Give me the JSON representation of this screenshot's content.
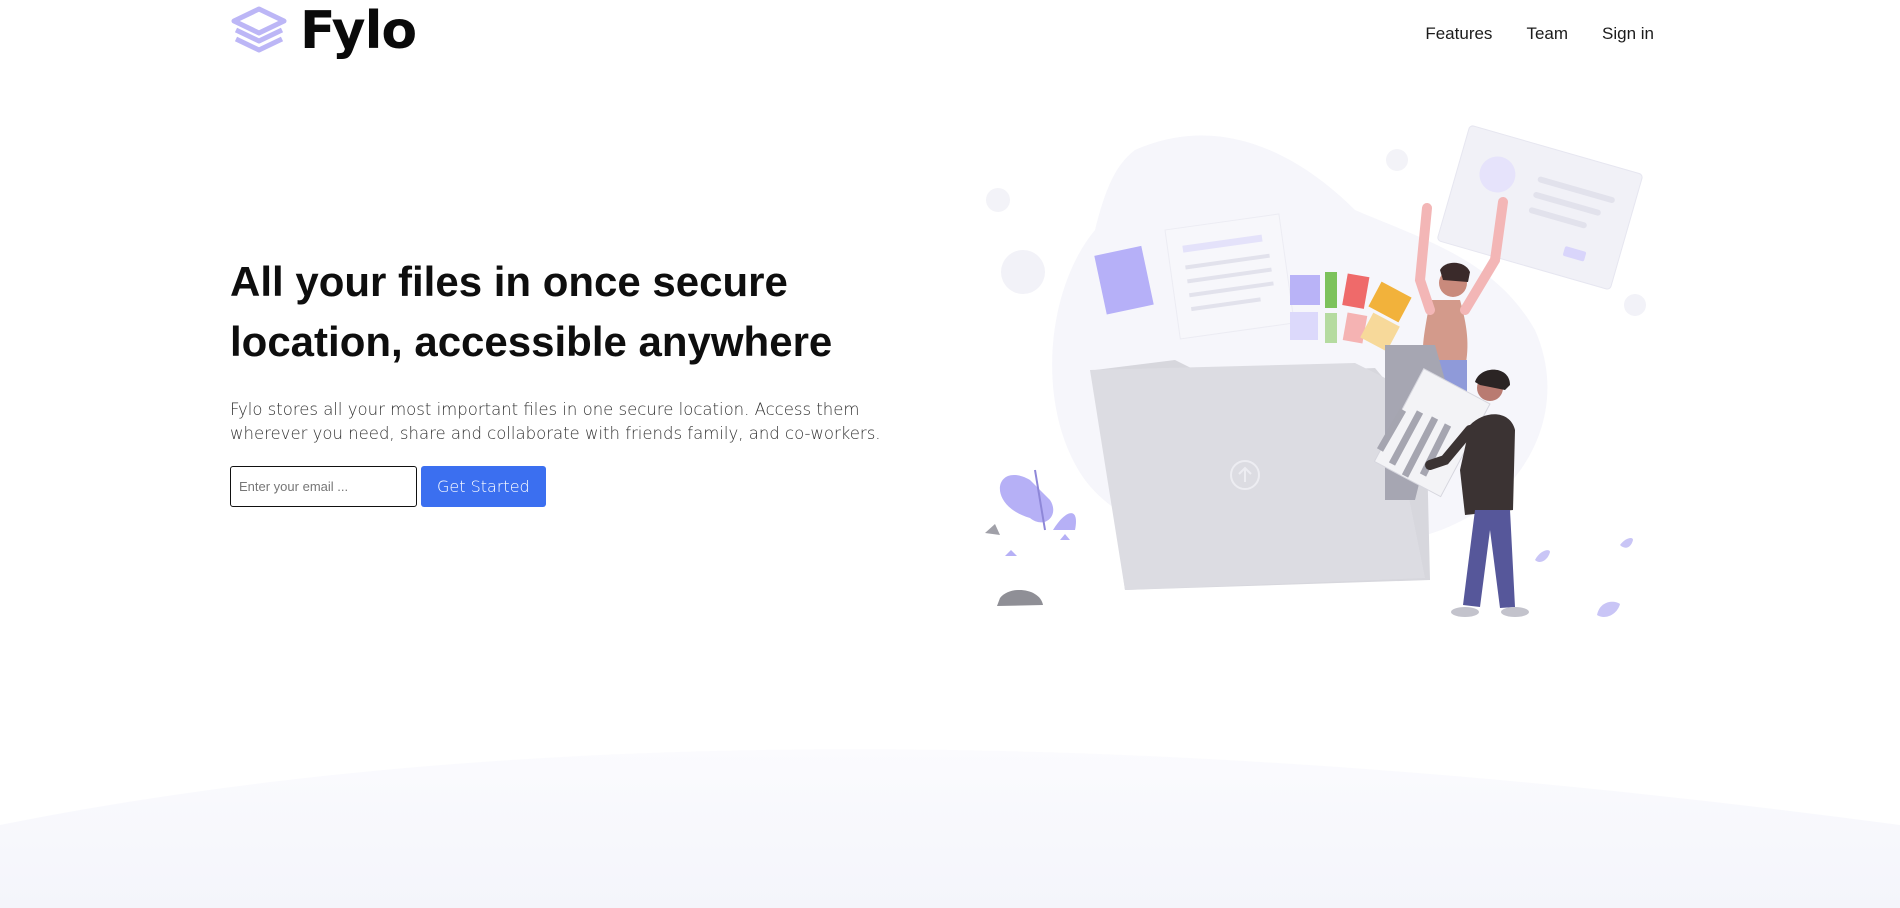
{
  "brand": {
    "name": "Fylo",
    "logo_icon": "layers-icon",
    "logo_color": "#b9b3f5"
  },
  "nav": {
    "items": [
      {
        "label": "Features"
      },
      {
        "label": "Team"
      },
      {
        "label": "Sign in"
      }
    ]
  },
  "hero": {
    "headline": "All your files in once secure location, accessible anywhere",
    "subtext": "Fylo stores all your most important files in one secure location. Access them wherever you need, share and collaborate with friends family, and co-workers.",
    "email_placeholder": "Enter your email ...",
    "cta_label": "Get Started",
    "cta_color": "#3b6ff0"
  },
  "illustration": {
    "icon": "people-with-folder-illustration",
    "accent": "#b7b1f7"
  }
}
